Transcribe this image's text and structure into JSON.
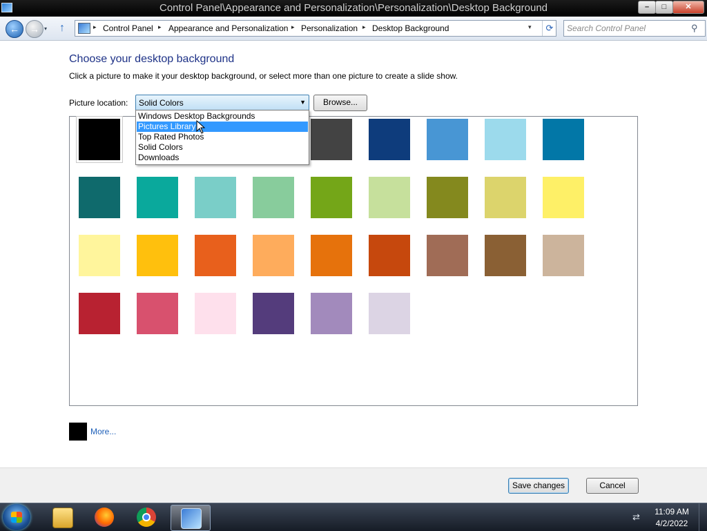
{
  "window": {
    "title": "Control Panel\\Appearance and Personalization\\Personalization\\Desktop Background",
    "controls": {
      "minimize": "–",
      "maximize": "□",
      "close": "✕"
    }
  },
  "navigation": {
    "back_glyph": "←",
    "forward_glyph": "→",
    "recent_glyph": "▾",
    "up_glyph": "↑",
    "breadcrumbs": [
      "Control Panel",
      "Appearance and Personalization",
      "Personalization",
      "Desktop Background"
    ],
    "separator": "▸",
    "dropdown_glyph": "▾",
    "refresh_glyph": "⟳",
    "search_placeholder": "Search Control Panel",
    "search_glyph": "⚲"
  },
  "content": {
    "heading": "Choose your desktop background",
    "instruction": "Click a picture to make it your desktop background, or select more than one picture to create a slide show.",
    "picture_location_label": "Picture location:",
    "picture_location_value": "Solid Colors",
    "select_arrow": "▼",
    "browse_label": "Browse...",
    "dropdown_options": [
      "Windows Desktop Backgrounds",
      "Pictures Library",
      "Top Rated Photos",
      "Solid Colors",
      "Downloads"
    ],
    "highlighted_option": "Pictures Library",
    "swatch_colors": [
      "#000000",
      "#6c6c6c",
      "#9a9a9a",
      "#c8c8c8",
      "#434343",
      "#0e3c7c",
      "#4896d4",
      "#9cdaec",
      "#0277a7",
      "#0f6a6c",
      "#0aa99c",
      "#7acec8",
      "#88cc9c",
      "#74a618",
      "#c6e09c",
      "#84891e",
      "#dcd46c",
      "#fef067",
      "#fff59c",
      "#ffc00d",
      "#e8601c",
      "#feac5c",
      "#e6720c",
      "#c6480d",
      "#a06c56",
      "#8a6034",
      "#ccb49c",
      "#b82231",
      "#d8516e",
      "#fee0ec",
      "#543c7c",
      "#a28abc",
      "#dcd4e4"
    ],
    "selected_swatch_index": 0,
    "more_swatch_color": "#000000",
    "more_link": "More..."
  },
  "footer": {
    "save_label": "Save changes",
    "cancel_label": "Cancel"
  },
  "taskbar": {
    "apps": [
      "windows-explorer",
      "firefox",
      "chrome",
      "control-panel"
    ],
    "active_app": "control-panel",
    "tray_glyph": "⇄",
    "time": "11:09 AM",
    "date": "4/2/2022"
  }
}
